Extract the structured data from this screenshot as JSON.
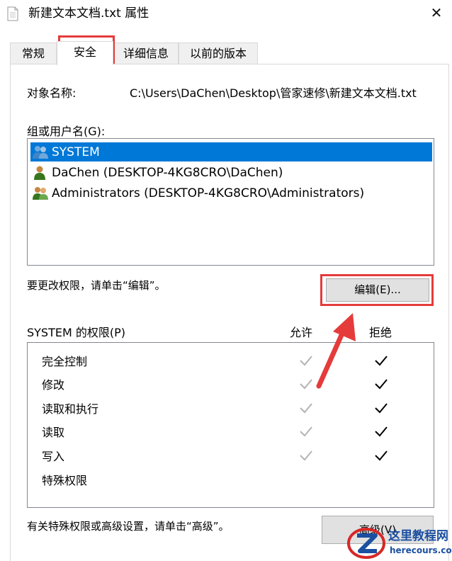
{
  "window": {
    "title": "新建文本文档.txt 属性",
    "close_glyph": "✕"
  },
  "tabs": [
    {
      "label": "常规",
      "active": false
    },
    {
      "label": "安全",
      "active": true
    },
    {
      "label": "详细信息",
      "active": false
    },
    {
      "label": "以前的版本",
      "active": false
    }
  ],
  "security": {
    "object_name_label": "对象名称:",
    "object_name_value": "C:\\Users\\DaChen\\Desktop\\管家速修\\新建文本文档.txt",
    "group_label": "组或用户名(G):",
    "users": [
      {
        "name": "SYSTEM",
        "icon": "users-group-icon",
        "selected": true
      },
      {
        "name": "DaChen (DESKTOP-4KG8CRO\\DaChen)",
        "icon": "user-icon",
        "selected": false
      },
      {
        "name": "Administrators (DESKTOP-4KG8CRO\\Administrators)",
        "icon": "users-group-icon",
        "selected": false
      }
    ],
    "change_hint": "要更改权限，请单击“编辑”。",
    "edit_button": "编辑(E)...",
    "permissions_header": "SYSTEM 的权限(P)",
    "allow_header": "允许",
    "deny_header": "拒绝",
    "permissions": [
      {
        "name": "完全控制",
        "allow": true,
        "deny": true
      },
      {
        "name": "修改",
        "allow": true,
        "deny": true
      },
      {
        "name": "读取和执行",
        "allow": true,
        "deny": true
      },
      {
        "name": "读取",
        "allow": true,
        "deny": true
      },
      {
        "name": "写入",
        "allow": true,
        "deny": true
      },
      {
        "name": "特殊权限",
        "allow": false,
        "deny": false
      }
    ],
    "advanced_hint": "有关特殊权限或高级设置，请单击“高级”。",
    "advanced_button": "高级(V)"
  },
  "annotation_color": "#e53b3b",
  "selection_color": "#0078d7",
  "watermark": {
    "name": "这里教程网",
    "url": "herecours.com"
  }
}
